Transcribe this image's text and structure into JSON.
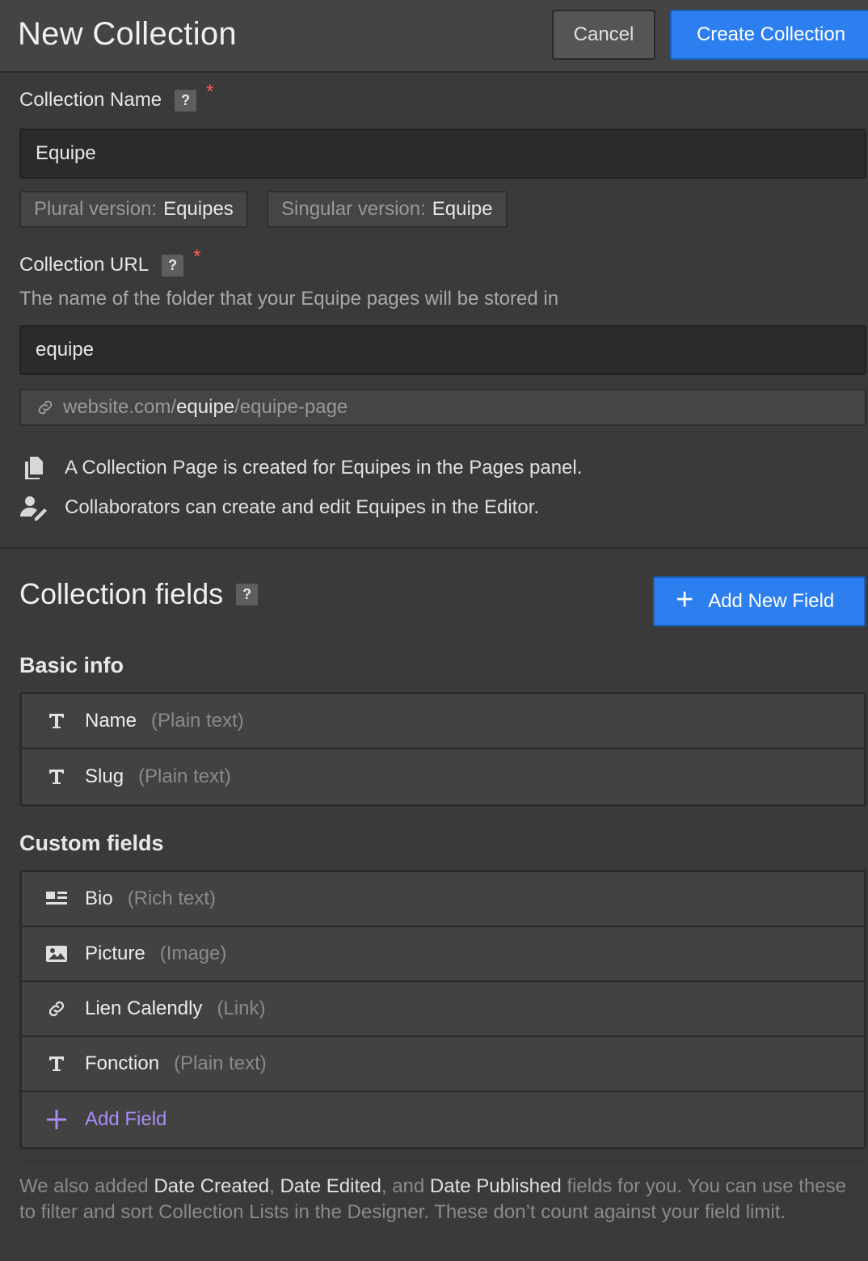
{
  "header": {
    "title": "New Collection",
    "cancel_label": "Cancel",
    "create_label": "Create Collection"
  },
  "name_section": {
    "label": "Collection Name",
    "help": "?",
    "required": "*",
    "value": "Equipe",
    "plural_label": "Plural version:",
    "plural_value": "Equipes",
    "singular_label": "Singular version:",
    "singular_value": "Equipe"
  },
  "url_section": {
    "label": "Collection URL",
    "help": "?",
    "required": "*",
    "hint": "The name of the folder that your Equipe pages will be stored in",
    "value": "equipe",
    "preview_prefix": "website.com/",
    "preview_slug": "equipe",
    "preview_suffix": "/equipe-page"
  },
  "info": [
    {
      "icon": "pages-icon",
      "text": "A Collection Page is created for Equipes in the Pages panel."
    },
    {
      "icon": "collaborator-edit-icon",
      "text": "Collaborators can create and edit Equipes in the Editor."
    }
  ],
  "fields_section": {
    "title": "Collection fields",
    "help": "?",
    "add_new_label": "Add New Field",
    "basic_title": "Basic info",
    "basic_fields": [
      {
        "icon": "text-icon",
        "name": "Name",
        "type": "(Plain text)"
      },
      {
        "icon": "text-icon",
        "name": "Slug",
        "type": "(Plain text)"
      }
    ],
    "custom_title": "Custom fields",
    "custom_fields": [
      {
        "icon": "rich-text-icon",
        "name": "Bio",
        "type": "(Rich text)"
      },
      {
        "icon": "image-icon",
        "name": "Picture",
        "type": "(Image)"
      },
      {
        "icon": "link-icon",
        "name": "Lien Calendly",
        "type": "(Link)"
      },
      {
        "icon": "text-icon",
        "name": "Fonction",
        "type": "(Plain text)"
      }
    ],
    "add_field_label": "Add Field"
  },
  "footer": {
    "p1": "We also added ",
    "date_created": "Date Created",
    "sep1": ", ",
    "date_edited": "Date Edited",
    "sep2": ", and ",
    "date_published": "Date Published",
    "p2": " fields for you. You can use these to filter and sort Collection Lists in the Designer. These don’t count against your field limit."
  },
  "colors": {
    "accent": "#2d7ff0",
    "required": "#ff5a5a",
    "add_field": "#a98cf5"
  }
}
